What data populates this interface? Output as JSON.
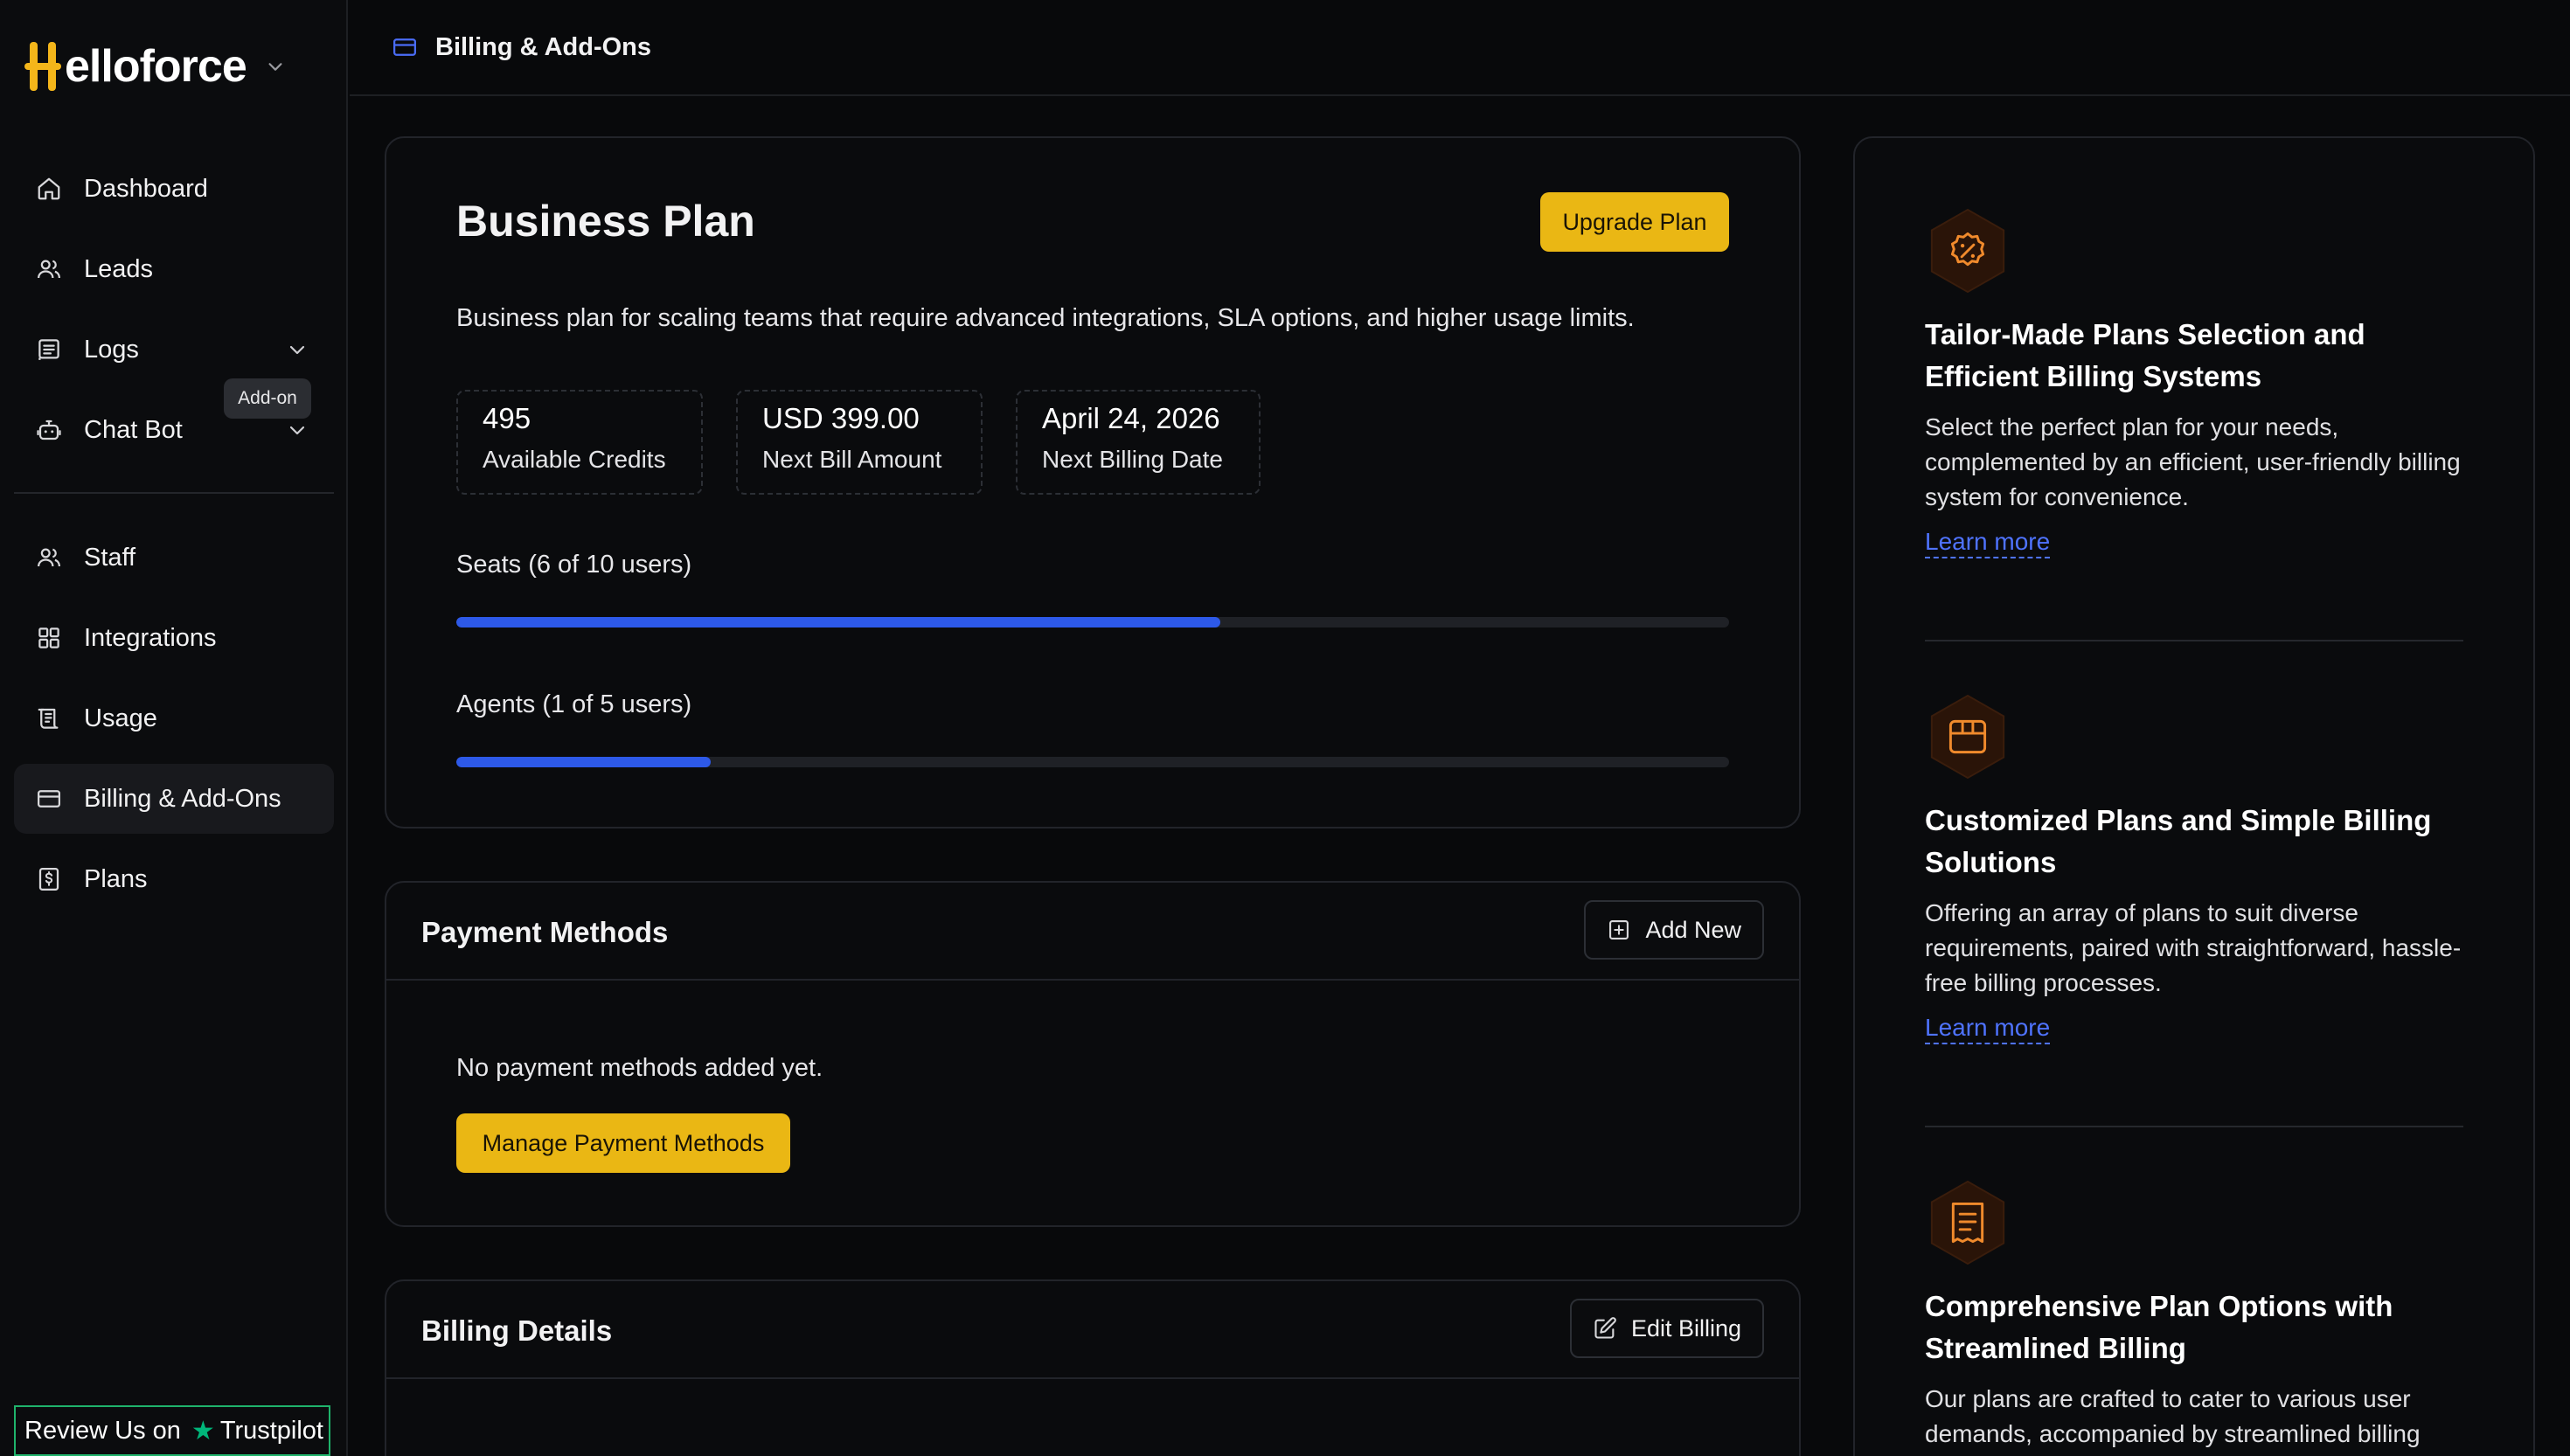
{
  "brand": {
    "name": "elloforce",
    "accent": "#f4b61a"
  },
  "sidebar": {
    "items": [
      {
        "label": "Dashboard",
        "icon": "home-icon"
      },
      {
        "label": "Leads",
        "icon": "users-icon"
      },
      {
        "label": "Logs",
        "icon": "logs-icon"
      },
      {
        "label": "Chat Bot",
        "icon": "bot-icon"
      },
      {
        "label": "Staff",
        "icon": "users-icon"
      },
      {
        "label": "Integrations",
        "icon": "grid-icon"
      },
      {
        "label": "Usage",
        "icon": "scroll-icon"
      },
      {
        "label": "Billing & Add-Ons",
        "icon": "credit-card-icon"
      },
      {
        "label": "Plans",
        "icon": "dollar-file-icon"
      }
    ],
    "addon_badge": "Add-on",
    "review": {
      "prefix": "Review Us on",
      "brand": "Trustpilot"
    }
  },
  "header": {
    "title": "Billing & Add-Ons"
  },
  "plan": {
    "name": "Business Plan",
    "upgrade_label": "Upgrade Plan",
    "description": "Business plan for scaling teams that require advanced integrations, SLA options, and higher usage limits.",
    "stats": [
      {
        "value": "495",
        "label": "Available Credits"
      },
      {
        "value": "USD 399.00",
        "label": "Next Bill Amount"
      },
      {
        "value": "April 24, 2026",
        "label": "Next Billing Date"
      }
    ],
    "seats": {
      "label": "Seats (6 of 10 users)",
      "progress": 0.6
    },
    "agents": {
      "label": "Agents (1 of 5 users)",
      "progress": 0.2
    }
  },
  "payment": {
    "title": "Payment Methods",
    "add_label": "Add New",
    "empty_text": "No payment methods added yet.",
    "manage_label": "Manage Payment Methods"
  },
  "billing_details": {
    "title": "Billing Details",
    "edit_label": "Edit Billing"
  },
  "info": [
    {
      "icon": "percent-badge-icon",
      "title": "Tailor-Made Plans Selection and Efficient Billing Systems",
      "text": "Select the perfect plan for your needs, complemented by an efficient, user-friendly billing system for convenience.",
      "link": "Learn more"
    },
    {
      "icon": "box-icon",
      "title": "Customized Plans and Simple Billing Solutions",
      "text": "Offering an array of plans to suit diverse requirements, paired with straightforward, hassle-free billing processes.",
      "link": "Learn more"
    },
    {
      "icon": "receipt-icon",
      "title": "Comprehensive Plan Options with Streamlined Billing",
      "text": "Our plans are crafted to cater to various user demands, accompanied by streamlined billing",
      "link": ""
    }
  ]
}
